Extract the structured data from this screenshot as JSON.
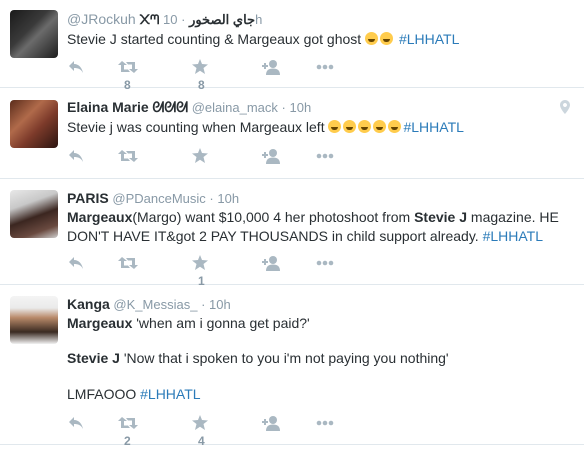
{
  "tweets": [
    {
      "fullname": "@JRockuh",
      "name_suffix": "᙭ᘉ جاي الصخور",
      "username": "",
      "time": "10h",
      "text_pre": "Stevie J started counting & Margeaux got ghost ",
      "emoji_count": 2,
      "hashtag": "#LHHATL",
      "retweets": "8",
      "favorites": "8"
    },
    {
      "fullname": "Elaina Marie",
      "name_suffix": "ᘛᘛᘛ",
      "username": "@elaina_mack",
      "time": "10h",
      "text_pre": "Stevie j was counting when Margeaux left ",
      "emoji_count": 5,
      "hashtag": "#LHHATL",
      "retweets": "",
      "favorites": ""
    },
    {
      "fullname": "PARIS",
      "username": "@PDanceMusic",
      "time": "10h",
      "t3_bold1": "Margeaux",
      "t3_part1": "(Margo) want $10,000 4 her photoshoot from ",
      "t3_bold2": "Stevie J",
      "t3_part2": " magazine. HE DON'T HAVE IT&got 2 PAY THOUSANDS in child support already. ",
      "hashtag": "#LHHATL",
      "retweets": "",
      "favorites": "1"
    },
    {
      "fullname": "Kanga",
      "username": "@K_Messias_",
      "time": "10h",
      "t4_bold1": "Margeaux",
      "t4_line1": " 'when am i gonna get paid?'",
      "t4_bold2": "Stevie J",
      "t4_line2": " 'Now that i spoken to you i'm not paying you nothing'",
      "t4_line3": "LMFAOOO ",
      "hashtag": "#LHHATL",
      "retweets": "2",
      "favorites": "4"
    }
  ],
  "separator": "·",
  "colors": {
    "link": "#2b7bb9",
    "meta": "#8899a6",
    "icon": "#aab8c2",
    "text": "#292f33"
  },
  "icons": [
    "reply-icon",
    "retweet-icon",
    "favorite-icon",
    "follow-icon",
    "more-icon",
    "location-pin-icon"
  ]
}
